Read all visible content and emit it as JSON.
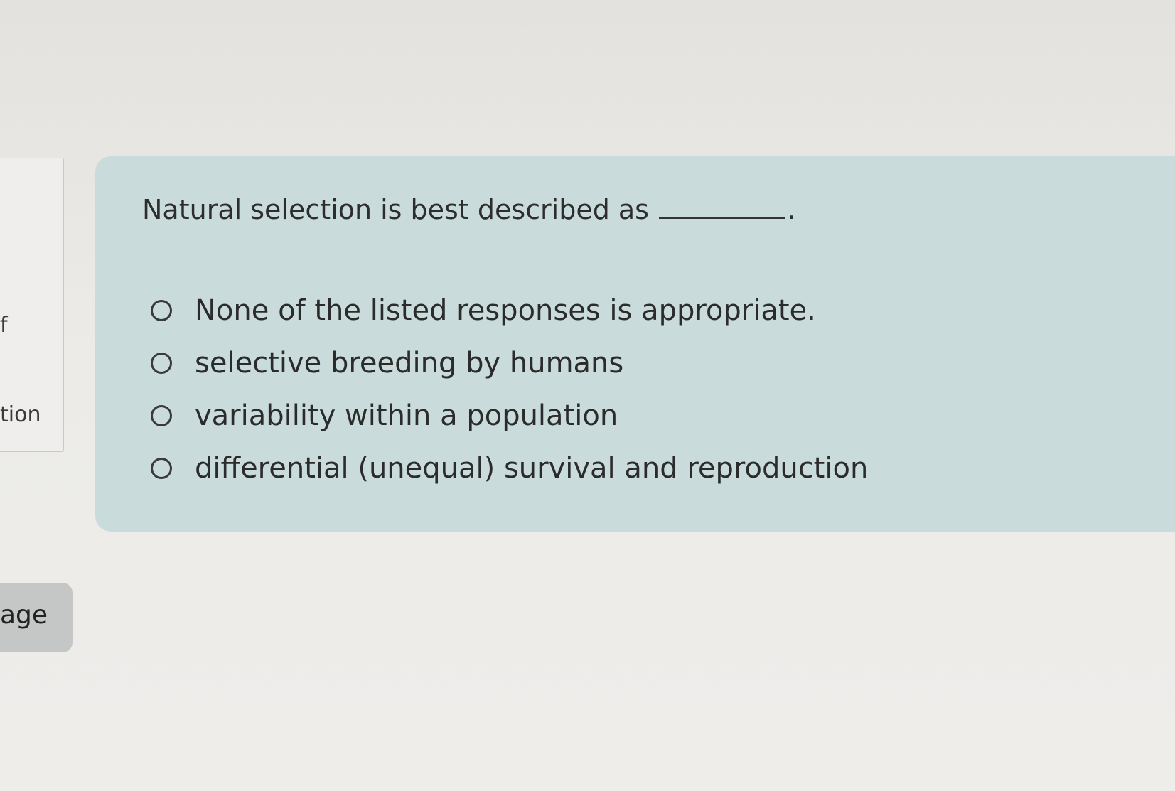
{
  "sidebar": {
    "fragment_mark": "f",
    "fragment_label": "tion",
    "page_button_label": "age"
  },
  "question": {
    "prompt": "Natural selection is best described as",
    "blank_period": ".",
    "options": [
      {
        "label": "None of the listed responses is appropriate.",
        "selected": false
      },
      {
        "label": "selective breeding by humans",
        "selected": false
      },
      {
        "label": "variability within a population",
        "selected": false
      },
      {
        "label": "differential (unequal) survival and reproduction",
        "selected": false
      }
    ]
  },
  "colors": {
    "card_background": "#c9dcdb",
    "page_background": "#eceae7",
    "page_button": "#c4c7c6"
  }
}
